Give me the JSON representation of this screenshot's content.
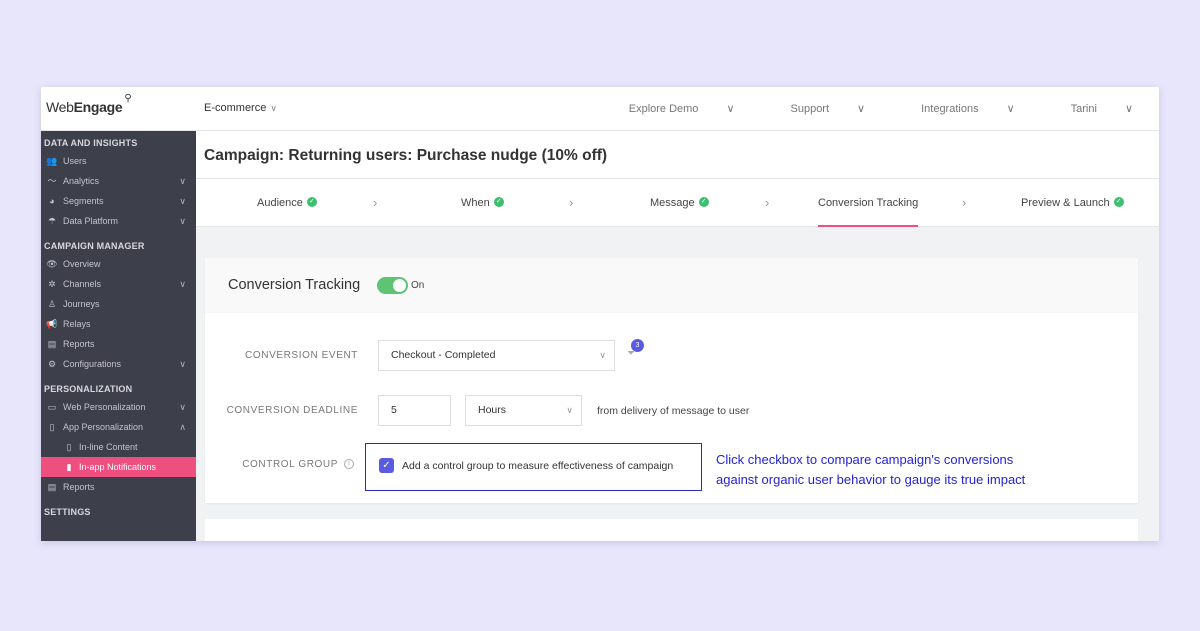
{
  "topbar": {
    "logo_web": "Web",
    "logo_engage": "Engage",
    "project": "E-commerce",
    "nav": [
      "Explore Demo",
      "Support",
      "Integrations",
      "Tarini"
    ]
  },
  "sidebar": {
    "sections": [
      {
        "title": "DATA AND INSIGHTS",
        "items": [
          {
            "label": "Users",
            "icon": "users-icon",
            "glyph": "👥",
            "arrow": false
          },
          {
            "label": "Analytics",
            "icon": "analytics-icon",
            "glyph": "〜",
            "arrow": true
          },
          {
            "label": "Segments",
            "icon": "segments-icon",
            "glyph": "◕",
            "arrow": true
          },
          {
            "label": "Data Platform",
            "icon": "data-platform-icon",
            "glyph": "☂",
            "arrow": true
          }
        ]
      },
      {
        "title": "CAMPAIGN MANAGER",
        "items": [
          {
            "label": "Overview",
            "icon": "eye-icon",
            "glyph": "👁",
            "arrow": false
          },
          {
            "label": "Channels",
            "icon": "channels-icon",
            "glyph": "✲",
            "arrow": true
          },
          {
            "label": "Journeys",
            "icon": "journeys-icon",
            "glyph": "♙",
            "arrow": false
          },
          {
            "label": "Relays",
            "icon": "megaphone-icon",
            "glyph": "📢",
            "arrow": false
          },
          {
            "label": "Reports",
            "icon": "report-icon",
            "glyph": "▤",
            "arrow": false
          },
          {
            "label": "Configurations",
            "icon": "configurations-icon",
            "glyph": "⚙",
            "arrow": true
          }
        ]
      },
      {
        "title": "PERSONALIZATION",
        "items": [
          {
            "label": "Web Personalization",
            "icon": "browser-icon",
            "glyph": "▭",
            "arrow": true
          },
          {
            "label": "App Personalization",
            "icon": "mobile-icon",
            "glyph": "▯",
            "arrow": "up"
          },
          {
            "label": "In-line Content",
            "icon": "inline-content-icon",
            "glyph": "▯",
            "sub": true
          },
          {
            "label": "In-app Notifications",
            "icon": "in-app-icon",
            "glyph": "▮",
            "sub": true,
            "active": true
          },
          {
            "label": "Reports",
            "icon": "report-icon",
            "glyph": "▤",
            "arrow": false
          }
        ]
      },
      {
        "title": "SETTINGS",
        "items": []
      }
    ]
  },
  "campaign": {
    "title": "Campaign: Returning users: Purchase nudge (10% off)"
  },
  "steps": [
    {
      "label": "Audience",
      "done": true
    },
    {
      "label": "When",
      "done": true
    },
    {
      "label": "Message",
      "done": true
    },
    {
      "label": "Conversion Tracking",
      "done": false,
      "active": true
    },
    {
      "label": "Preview & Launch",
      "done": true
    }
  ],
  "conversion": {
    "title": "Conversion Tracking",
    "toggle_label": "On",
    "toggle_on": true,
    "event_label": "CONVERSION EVENT",
    "event_value": "Checkout - Completed",
    "filter_count": "3",
    "deadline_label": "CONVERSION DEADLINE",
    "deadline_value": "5",
    "deadline_unit": "Hours",
    "deadline_suffix": "from delivery of message to user",
    "control_label": "CONTROL GROUP",
    "control_checked": true,
    "control_text": "Add a control group to measure effectiveness of campaign"
  },
  "callout": {
    "line1": "Click checkbox to compare campaign's conversions",
    "line2": "against organic user behavior to gauge its true impact"
  },
  "colors": {
    "accent": "#ef4f7e",
    "sidebar": "#3d3f4b",
    "toggle": "#5cc473",
    "check": "#5b5be0",
    "callout": "#2323d6"
  }
}
